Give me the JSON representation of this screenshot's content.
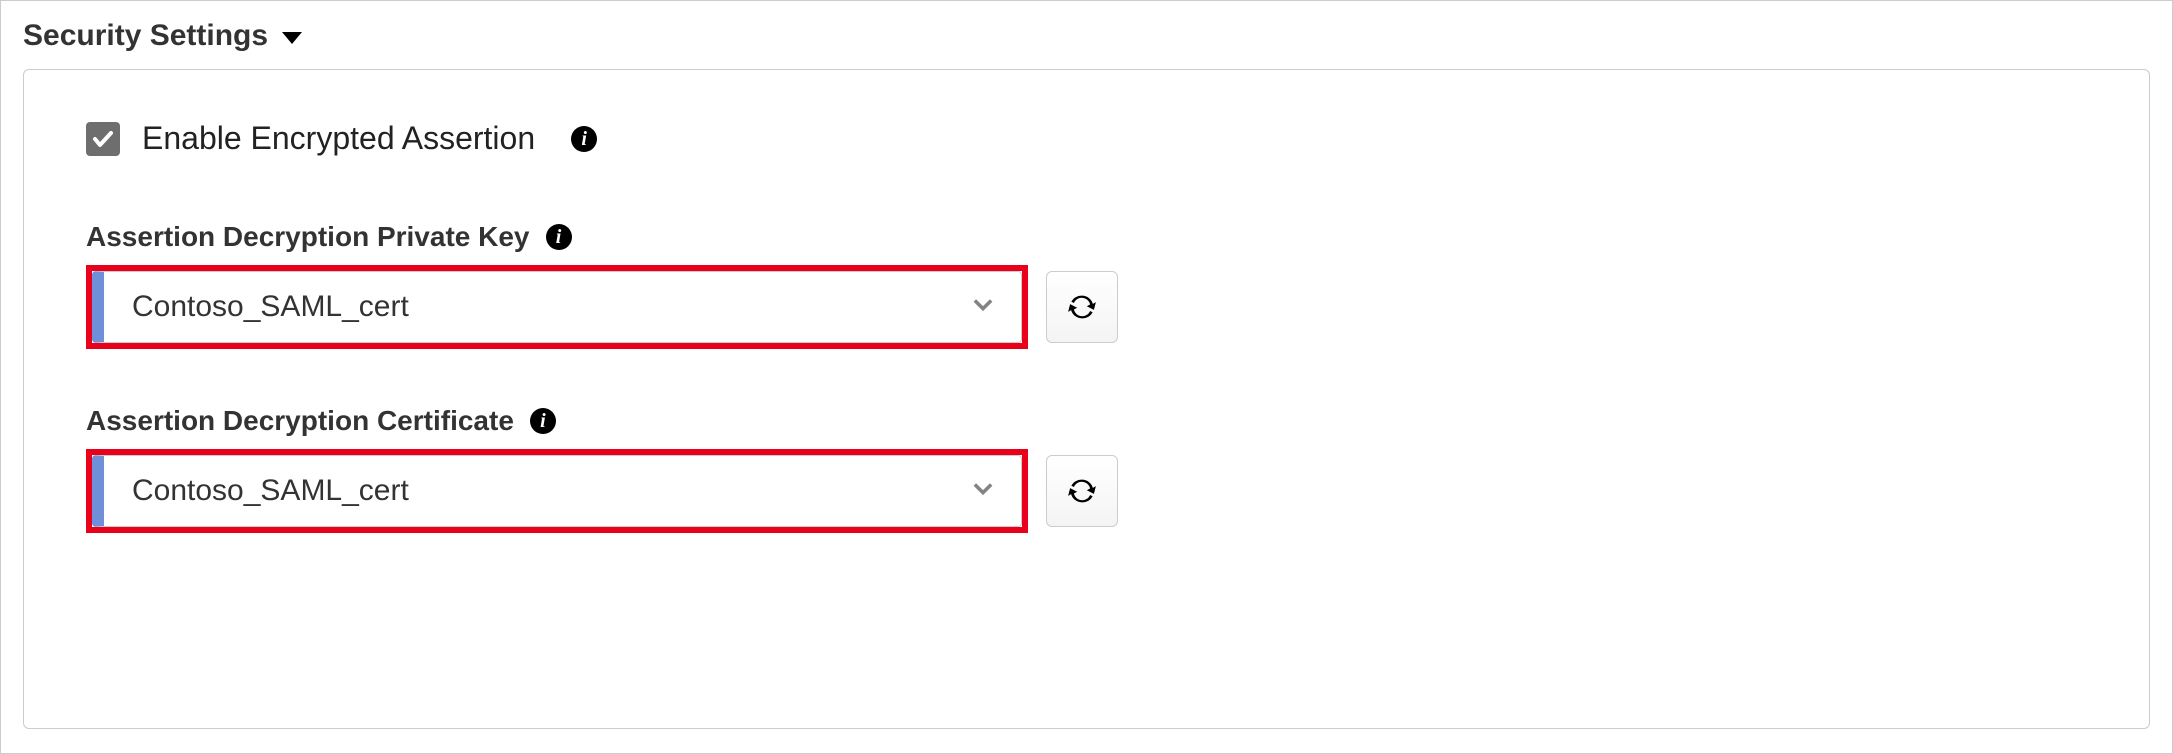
{
  "section": {
    "title": "Security Settings"
  },
  "checkbox": {
    "label": "Enable Encrypted Assertion",
    "checked": true
  },
  "fields": {
    "privateKey": {
      "label": "Assertion Decryption Private Key",
      "value": "Contoso_SAML_cert"
    },
    "certificate": {
      "label": "Assertion Decryption Certificate",
      "value": "Contoso_SAML_cert"
    }
  },
  "info_glyph": "i",
  "colors": {
    "highlight": "#e9001b",
    "select_accent": "#6f8fd8",
    "checkbox_bg": "#6e6e6e"
  }
}
